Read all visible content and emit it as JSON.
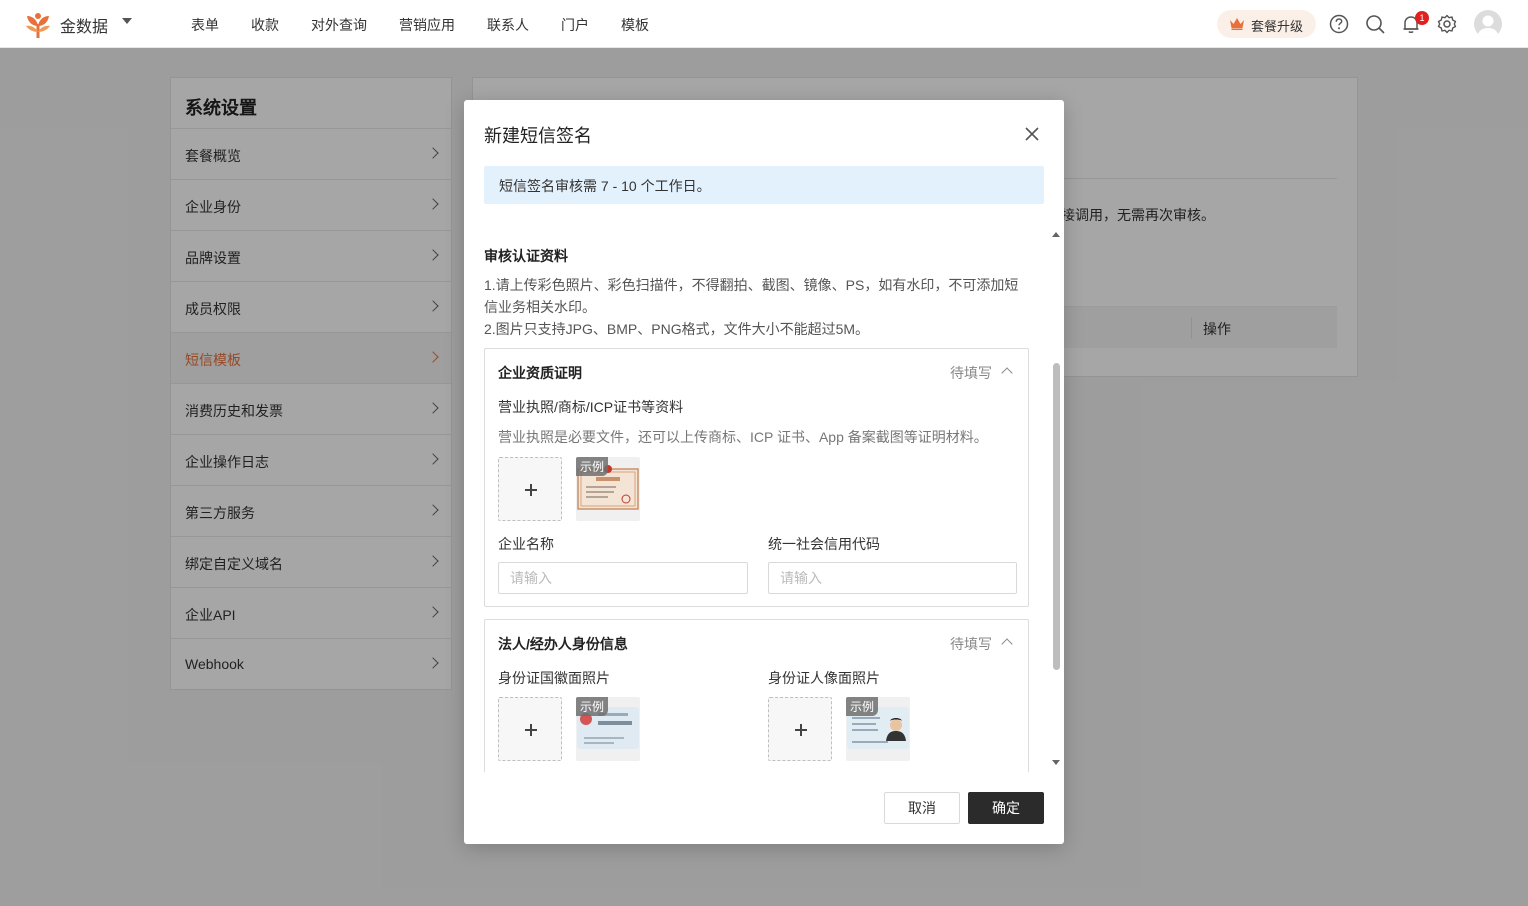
{
  "app": {
    "brand": "金数据"
  },
  "nav": {
    "items": [
      "表单",
      "收款",
      "对外查询",
      "营销应用",
      "联系人",
      "门户",
      "模板"
    ]
  },
  "header": {
    "upgrade_label": "套餐升级",
    "notification_count": "1"
  },
  "sidebar": {
    "title": "系统设置",
    "items": [
      "套餐概览",
      "企业身份",
      "品牌设置",
      "成员权限",
      "短信模板",
      "消费历史和发票",
      "企业操作日志",
      "第三方服务",
      "绑定自定义域名",
      "企业API",
      "Webhook"
    ],
    "active": "短信模板"
  },
  "main": {
    "partial_text": "接调用，无需再次审核。",
    "table_header_ops": "操作"
  },
  "modal": {
    "title": "新建短信签名",
    "alert": "短信签名审核需 7 - 10 个工作日。",
    "section_title": "审核认证资料",
    "notes": [
      "1.请上传彩色照片、彩色扫描件，不得翻拍、截图、镜像、PS，如有水印，不可添加短信业务相关水印。",
      "2.图片只支持JPG、BMP、PNG格式，文件大小不能超过5M。"
    ],
    "card1": {
      "title": "企业资质证明",
      "status": "待填写",
      "upload_label": "营业执照/商标/ICP证书等资料",
      "upload_hint": "营业执照是必要文件，还可以上传商标、ICP 证书、App 备案截图等证明材料。",
      "sample_tag": "示例",
      "company_name_label": "企业名称",
      "company_name_placeholder": "请输入",
      "credit_code_label": "统一社会信用代码",
      "credit_code_placeholder": "请输入"
    },
    "card2": {
      "title": "法人/经办人身份信息",
      "status": "待填写",
      "id_front_label": "身份证国徽面照片",
      "id_back_label": "身份证人像面照片",
      "sample_tag": "示例"
    },
    "cancel_label": "取消",
    "ok_label": "确定"
  },
  "colors": {
    "accent": "#e8703a",
    "primary_button": "#2b2b2b",
    "alert_bg": "#e3f1fc"
  }
}
